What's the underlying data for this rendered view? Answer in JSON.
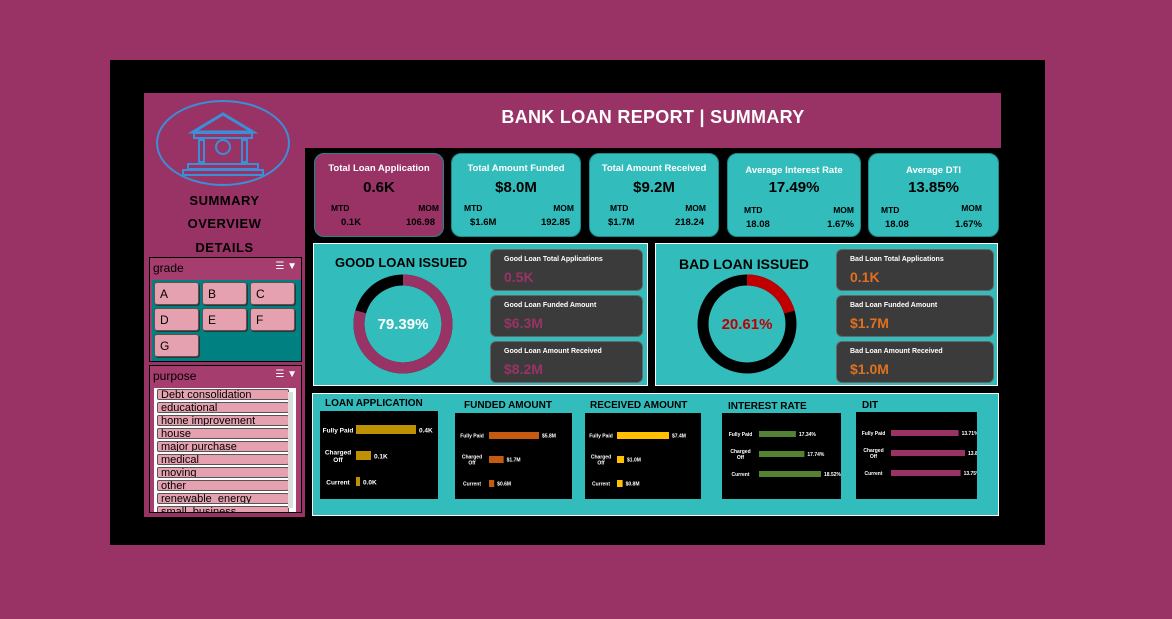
{
  "header": {
    "title": "BANK LOAN REPORT | SUMMARY"
  },
  "nav": {
    "items": [
      "SUMMARY",
      "OVERVIEW",
      "DETAILS"
    ]
  },
  "grade_slicer": {
    "title": "grade",
    "items": [
      "A",
      "B",
      "C",
      "D",
      "E",
      "F",
      "G"
    ]
  },
  "purpose_slicer": {
    "title": "purpose",
    "items": [
      "Debt consolidation",
      "educational",
      "home improvement",
      "house",
      "major purchase",
      "medical",
      "moving",
      "other",
      "renewable_energy",
      "small_business"
    ]
  },
  "kpis": [
    {
      "label": "Total Loan Application",
      "value": "0.6K",
      "mtd_label": "MTD",
      "mtd": "0.1K",
      "mom_label": "MOM",
      "mom": "106.98"
    },
    {
      "label": "Total  Amount Funded",
      "value": "$8.0M",
      "mtd_label": "MTD",
      "mtd": "$1.6M",
      "mom_label": "MOM",
      "mom": "192.85"
    },
    {
      "label": "Total Amount Received",
      "value": "$9.2M",
      "mtd_label": "MTD",
      "mtd": "$1.7M",
      "mom_label": "MOM",
      "mom": "218.24"
    },
    {
      "label": "Average Interest Rate",
      "value": "17.49%",
      "mtd_label": "MTD",
      "mtd": "18.08",
      "mom_label": "MOM",
      "mom": "1.67%"
    },
    {
      "label": "Average DTI",
      "value": "13.85%",
      "mtd_label": "MTD",
      "mtd": "18.08",
      "mom_label": "MOM",
      "mom": "1.67%"
    }
  ],
  "good_loan": {
    "title": "GOOD LOAN ISSUED",
    "percent_label": "79.39%",
    "percent": 79.39,
    "ring_color": "#993366",
    "cards": [
      {
        "label": "Good Loan Total  Applications",
        "value": "0.5K"
      },
      {
        "label": "Good Loan Funded Amount",
        "value": "$6.3M"
      },
      {
        "label": "Good Loan Amount Received",
        "value": "$8.2M"
      }
    ],
    "value_color": "#993366"
  },
  "bad_loan": {
    "title": "BAD LOAN ISSUED",
    "percent_label": "20.61%",
    "percent": 20.61,
    "ring_color": "#c00000",
    "cards": [
      {
        "label": "Bad Loan Total Applications",
        "value": "0.1K"
      },
      {
        "label": "Bad Loan  Funded Amount",
        "value": "$1.7M"
      },
      {
        "label": "Bad Loan Amount Received",
        "value": "$1.0M"
      }
    ],
    "value_color": "#e07020"
  },
  "chart_data": [
    {
      "type": "bar",
      "title": "LOAN APPLICATION",
      "categories": [
        "Fully Paid",
        "Charged Off",
        "Current"
      ],
      "values": [
        0.4,
        0.1,
        0.0
      ],
      "labels": [
        "0.4K",
        "0.1K",
        "0.0K"
      ],
      "color": "#bf9000"
    },
    {
      "type": "bar",
      "title": "FUNDED AMOUNT",
      "categories": [
        "Fully Paid",
        "Charged Off",
        "Current"
      ],
      "values": [
        5.8,
        1.7,
        0.6
      ],
      "labels": [
        "$5.8M",
        "$1.7M",
        "$0.6M"
      ],
      "color": "#c55a11"
    },
    {
      "type": "bar",
      "title": "RECEIVED AMOUNT",
      "categories": [
        "Fully Paid",
        "Charged Off",
        "Current"
      ],
      "values": [
        7.4,
        1.0,
        0.8
      ],
      "labels": [
        "$7.4M",
        "$1.0M",
        "$0.8M"
      ],
      "color": "#ffc000"
    },
    {
      "type": "bar",
      "title": "INTEREST RATE",
      "categories": [
        "Fully Paid",
        "Charged Off",
        "Current"
      ],
      "values": [
        17.34,
        17.74,
        18.52
      ],
      "labels": [
        "17.34%",
        "17.74%",
        "18.52%"
      ],
      "color": "#548235"
    },
    {
      "type": "bar",
      "title": "DIT",
      "categories": [
        "Fully Paid",
        "Charged Off",
        "Current"
      ],
      "values": [
        13.71,
        13.84,
        13.75
      ],
      "labels": [
        "13.71%",
        "13.84%",
        "13.75%"
      ],
      "color": "#993366"
    }
  ]
}
